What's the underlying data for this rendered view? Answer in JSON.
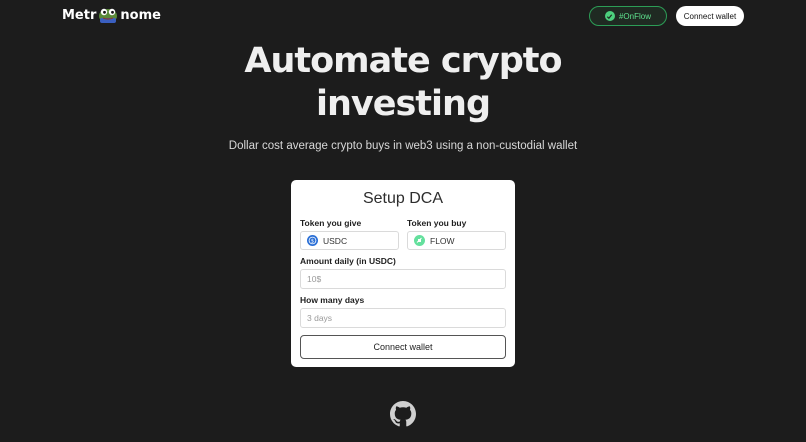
{
  "header": {
    "logo_left": "Metr",
    "logo_right": "nome",
    "onflow_label": "#OnFlow",
    "connect_label": "Connect wallet"
  },
  "hero": {
    "title_line1": "Automate crypto",
    "title_line2": "investing",
    "subtitle": "Dollar cost average crypto buys in web3 using a non-custodial wallet"
  },
  "card": {
    "title": "Setup DCA",
    "give_label": "Token you give",
    "give_value": "USDC",
    "buy_label": "Token you buy",
    "buy_value": "FLOW",
    "amount_label": "Amount daily (in USDC)",
    "amount_placeholder": "10$",
    "days_label": "How many days",
    "days_placeholder": "3 days",
    "connect_label": "Connect wallet"
  },
  "icons": {
    "logo": "pepe-mascot-icon",
    "onflow": "check-circle-icon",
    "usdc": "usdc-token-icon",
    "flow": "flow-token-icon",
    "footer": "github-icon"
  },
  "colors": {
    "background": "#1c1c1c",
    "accent_green": "#4cd07d",
    "card": "#ffffff"
  }
}
